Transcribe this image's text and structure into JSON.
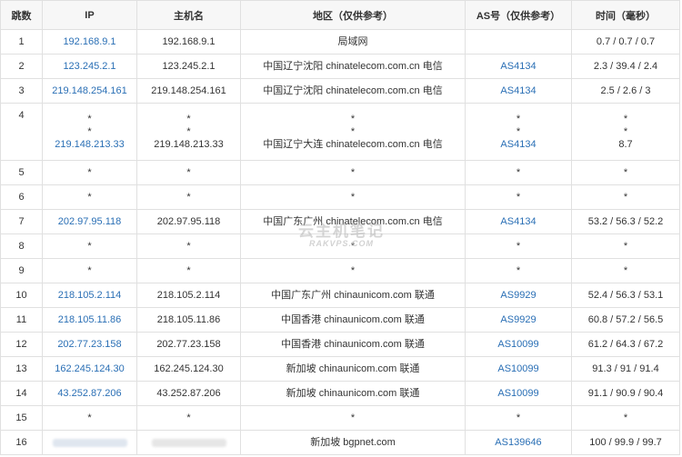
{
  "headers": {
    "hop": "跳数",
    "ip": "IP",
    "host": "主机名",
    "region": "地区（仅供参考）",
    "as": "AS号（仅供参考）",
    "time": "时间（毫秒）"
  },
  "watermark": {
    "title": "云主机笔记",
    "site": "RAKVPS.COM"
  },
  "rows": [
    {
      "hop": "1",
      "ip": "192.168.9.1",
      "host": "192.168.9.1",
      "region": "局域网",
      "as": "",
      "time": "0.7 / 0.7 / 0.7"
    },
    {
      "hop": "2",
      "ip": "123.245.2.1",
      "host": "123.245.2.1",
      "region": "中国辽宁沈阳 chinatelecom.com.cn 电信",
      "as": "AS4134",
      "time": "2.3 / 39.4 / 2.4"
    },
    {
      "hop": "3",
      "ip": "219.148.254.161",
      "host": "219.148.254.161",
      "region": "中国辽宁沈阳 chinatelecom.com.cn 电信",
      "as": "AS4134",
      "time": "2.5 / 2.6 / 3"
    },
    {
      "hop": "4",
      "star": "*",
      "ip": "219.148.213.33",
      "host": "219.148.213.33",
      "region": "中国辽宁大连 chinatelecom.com.cn 电信",
      "as": "AS4134",
      "time": "8.7"
    },
    {
      "hop": "5",
      "ip": "*",
      "host": "*",
      "region": "*",
      "as": "*",
      "time": "*"
    },
    {
      "hop": "6",
      "ip": "*",
      "host": "*",
      "region": "*",
      "as": "*",
      "time": "*"
    },
    {
      "hop": "7",
      "ip": "202.97.95.118",
      "host": "202.97.95.118",
      "region": "中国广东广州 chinatelecom.com.cn 电信",
      "as": "AS4134",
      "time": "53.2 / 56.3 / 52.2"
    },
    {
      "hop": "8",
      "ip": "*",
      "host": "*",
      "region": "*",
      "as": "*",
      "time": "*"
    },
    {
      "hop": "9",
      "ip": "*",
      "host": "*",
      "region": "*",
      "as": "*",
      "time": "*"
    },
    {
      "hop": "10",
      "ip": "218.105.2.114",
      "host": "218.105.2.114",
      "region": "中国广东广州 chinaunicom.com 联通",
      "as": "AS9929",
      "time": "52.4 / 56.3 / 53.1"
    },
    {
      "hop": "11",
      "ip": "218.105.11.86",
      "host": "218.105.11.86",
      "region": "中国香港 chinaunicom.com 联通",
      "as": "AS9929",
      "time": "60.8 / 57.2 / 56.5"
    },
    {
      "hop": "12",
      "ip": "202.77.23.158",
      "host": "202.77.23.158",
      "region": "中国香港 chinaunicom.com 联通",
      "as": "AS10099",
      "time": "61.2 / 64.3 / 67.2"
    },
    {
      "hop": "13",
      "ip": "162.245.124.30",
      "host": "162.245.124.30",
      "region": "新加坡 chinaunicom.com 联通",
      "as": "AS10099",
      "time": "91.3 / 91 / 91.4"
    },
    {
      "hop": "14",
      "ip": "43.252.87.206",
      "host": "43.252.87.206",
      "region": "新加坡 chinaunicom.com 联通",
      "as": "AS10099",
      "time": "91.1 / 90.9 / 90.4"
    },
    {
      "hop": "15",
      "ip": "*",
      "host": "*",
      "region": "*",
      "as": "*",
      "time": "*"
    },
    {
      "hop": "16",
      "region": "新加坡 bgpnet.com",
      "as": "AS139646",
      "time": "100 / 99.9 / 99.7"
    }
  ]
}
